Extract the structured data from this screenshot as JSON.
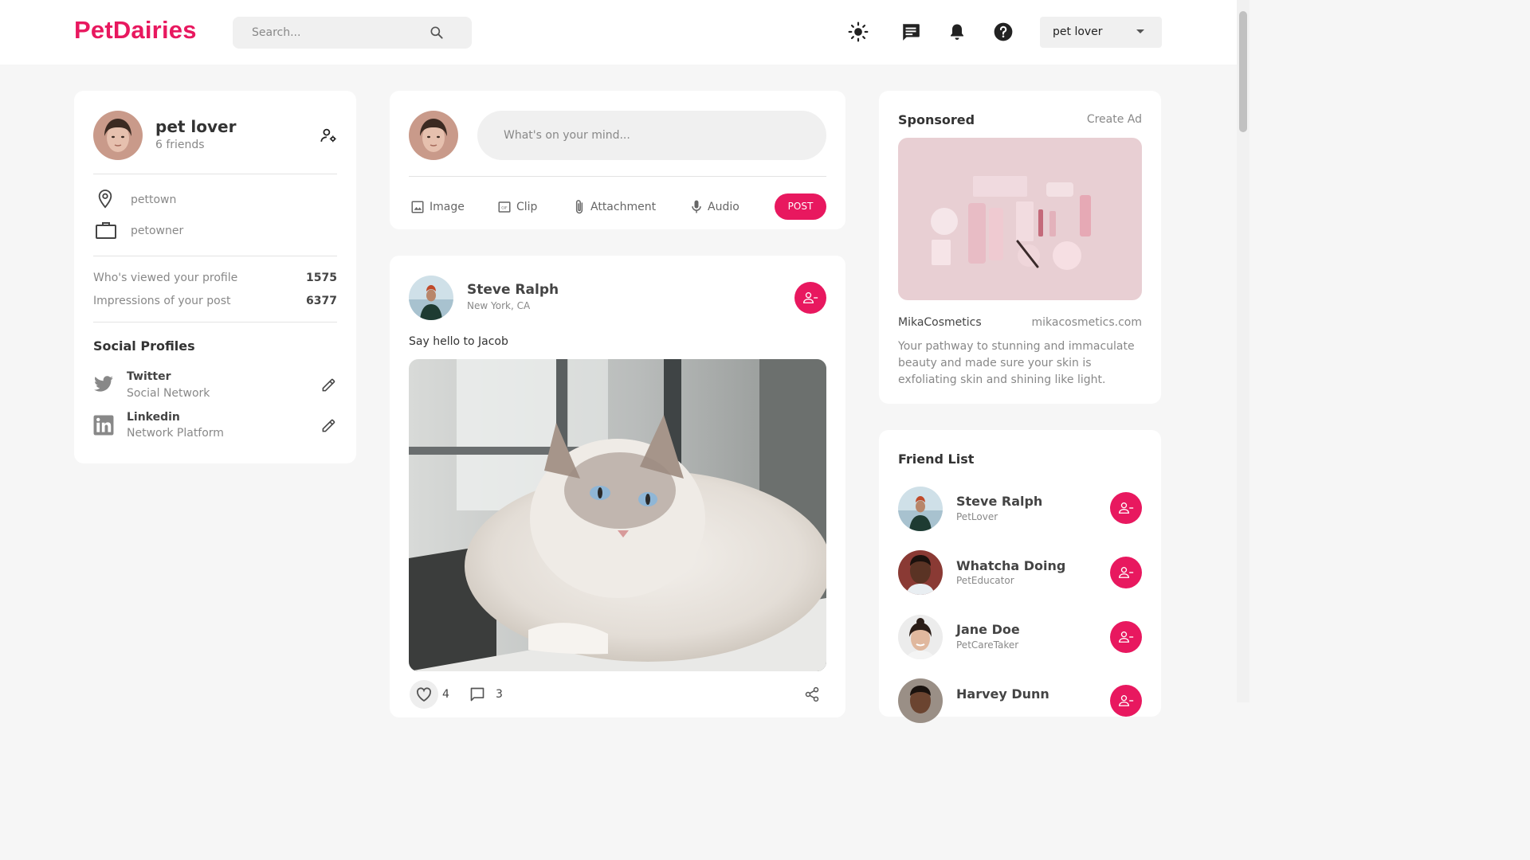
{
  "header": {
    "logo": "PetDairies",
    "search_placeholder": "Search...",
    "user_menu_value": "pet lover"
  },
  "profile": {
    "name": "pet lover",
    "friends": "6 friends",
    "location": "pettown",
    "occupation": "petowner",
    "stats": [
      {
        "label": "Who's viewed your profile",
        "value": "1575"
      },
      {
        "label": "Impressions of your post",
        "value": "6377"
      }
    ],
    "social_title": "Social Profiles",
    "social": [
      {
        "name": "Twitter",
        "type": "Social Network"
      },
      {
        "name": "Linkedin",
        "type": "Network Platform"
      }
    ]
  },
  "composer": {
    "placeholder": "What's on your mind...",
    "actions": [
      "Image",
      "Clip",
      "Attachment",
      "Audio"
    ],
    "post_label": "POST"
  },
  "post": {
    "author": "Steve Ralph",
    "location": "New York, CA",
    "text": "Say hello to Jacob",
    "likes": "4",
    "comments": "3"
  },
  "sponsored": {
    "title": "Sponsored",
    "create_ad": "Create Ad",
    "brand": "MikaCosmetics",
    "url": "mikacosmetics.com",
    "description": "Your pathway to stunning and immaculate beauty and made sure your skin is exfoliating skin and shining like light."
  },
  "friend_list": {
    "title": "Friend List",
    "friends": [
      {
        "name": "Steve Ralph",
        "role": "PetLover"
      },
      {
        "name": "Whatcha Doing",
        "role": "PetEducator"
      },
      {
        "name": "Jane Doe",
        "role": "PetCareTaker"
      },
      {
        "name": "Harvey Dunn",
        "role": ""
      }
    ]
  },
  "colors": {
    "accent": "#e8185f",
    "background": "#f6f6f6"
  }
}
